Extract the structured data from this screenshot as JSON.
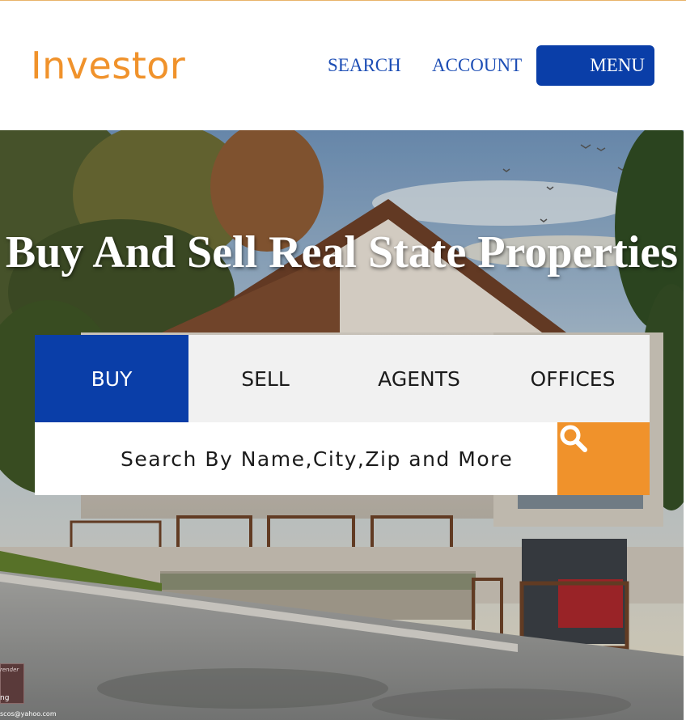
{
  "header": {
    "logo": "Investor",
    "nav": {
      "search_label": "SEARCH",
      "account_label": "ACCOUNT",
      "menu_label": "MENU"
    }
  },
  "hero": {
    "title": "Buy And Sell Real State Properties",
    "image": "house-exterior-photo",
    "watermark": {
      "line1": "render",
      "line2": "ng",
      "email": "scos@yahoo.com"
    }
  },
  "search": {
    "tabs": [
      {
        "label": "BUY",
        "active": true
      },
      {
        "label": "SELL",
        "active": false
      },
      {
        "label": "AGENTS",
        "active": false
      },
      {
        "label": "OFFICES",
        "active": false
      }
    ],
    "placeholder": "Search By Name,City,Zip and More",
    "button_icon": "search-icon"
  },
  "colors": {
    "brand_orange": "#f0922b",
    "brand_blue": "#0a3ea8",
    "nav_link_blue": "#1d4eb5",
    "tab_bar_bg": "#f1f1f1"
  }
}
